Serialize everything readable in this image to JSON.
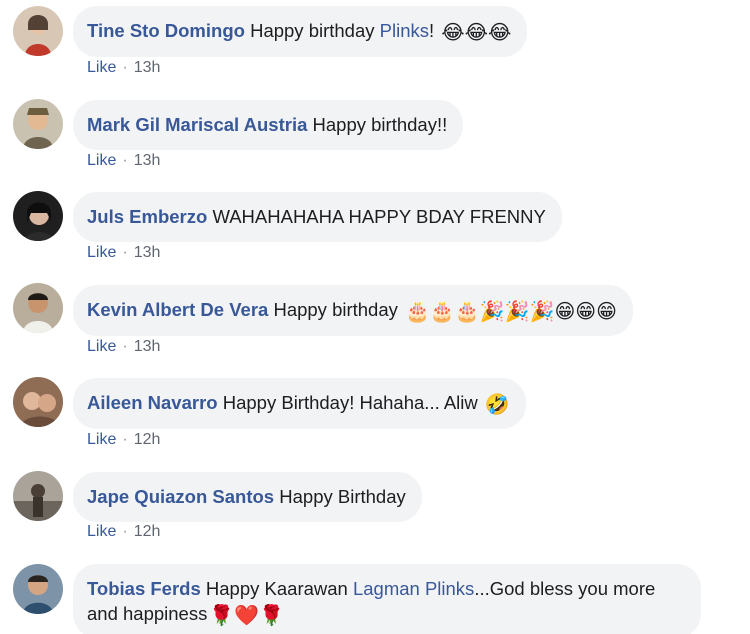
{
  "comments": [
    {
      "author": "Tine Sto Domingo",
      "text": "Happy birthday ",
      "mention": "Plinks",
      "after_mention": "!",
      "emoji": "😂😂😂",
      "like_label": "Like",
      "separator": "·",
      "time": "13h",
      "avatar_color": "#b5443a"
    },
    {
      "author": "Mark Gil Mariscal Austria",
      "text": "Happy birthday!!",
      "like_label": "Like",
      "separator": "·",
      "time": "13h",
      "avatar_color": "#8a7a5c"
    },
    {
      "author": "Juls Emberzo",
      "text": "WAHAHAHAHA HAPPY BDAY FRENNY",
      "like_label": "Like",
      "separator": "·",
      "time": "13h",
      "avatar_color": "#2e2e2e"
    },
    {
      "author": "Kevin Albert De Vera",
      "text": "Happy birthday ",
      "emoji": "🎂🎂🎂🎉🎉🎉😁😁😁",
      "like_label": "Like",
      "separator": "·",
      "time": "13h",
      "avatar_color": "#5a4634"
    },
    {
      "author": "Aileen Navarro",
      "text": "Happy Birthday! Hahaha... Aliw ",
      "emoji": "🤣",
      "like_label": "Like",
      "separator": "·",
      "time": "12h",
      "avatar_color": "#a0715a"
    },
    {
      "author": "Jape Quiazon Santos",
      "text": "Happy Birthday",
      "like_label": "Like",
      "separator": "·",
      "time": "12h",
      "avatar_color": "#5f5a52"
    },
    {
      "author": "Tobias Ferds",
      "text": "Happy Kaarawan ",
      "mention": "Lagman Plinks",
      "after_mention": "...God bless you more and happiness",
      "emoji": "🌹❤️🌹",
      "avatar_color": "#4a6a8a"
    }
  ]
}
